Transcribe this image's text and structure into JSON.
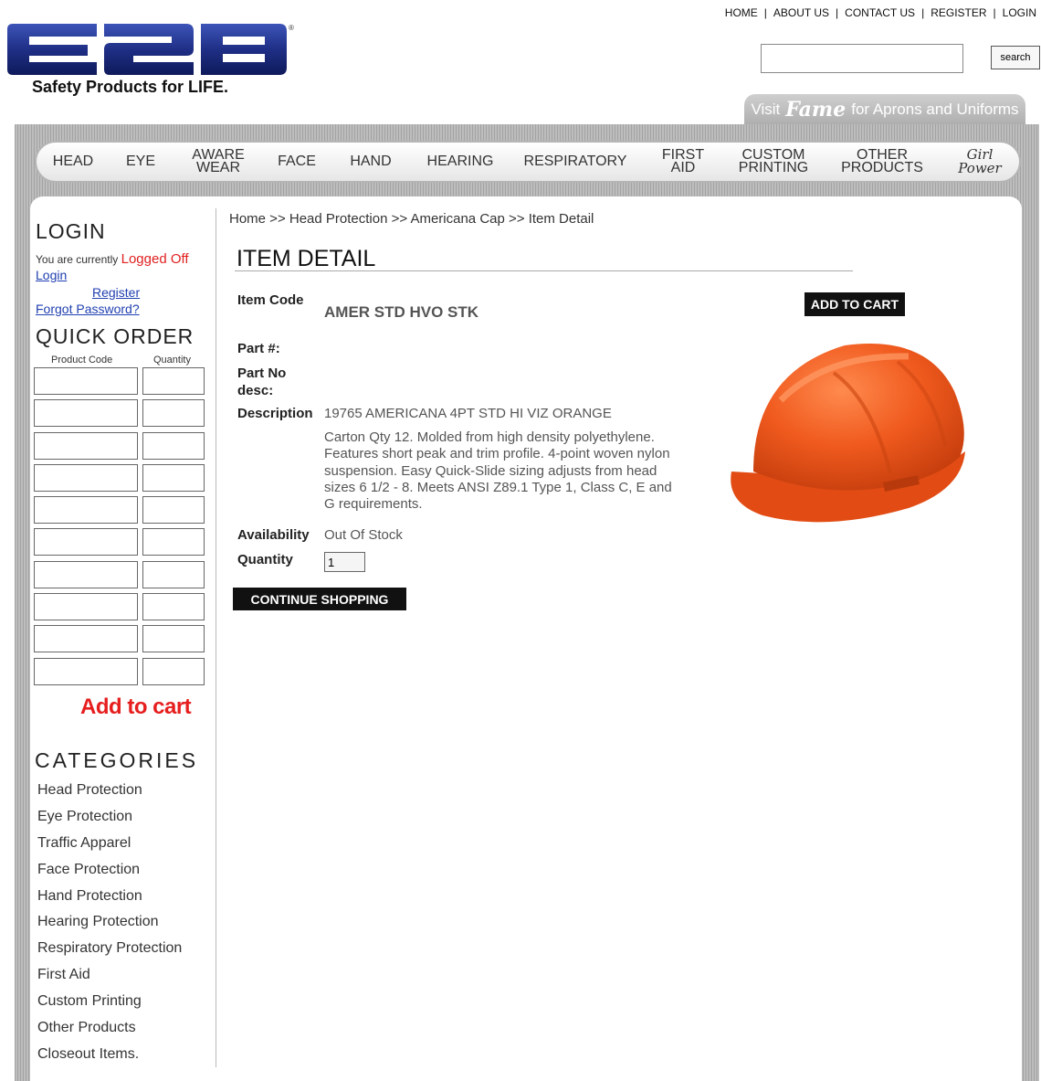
{
  "header": {
    "tagline": "Safety Products for LIFE.",
    "top_nav": [
      "HOME",
      "ABOUT US",
      "CONTACT US",
      "REGISTER",
      "LOGIN"
    ],
    "top_nav_separator": "|",
    "search": {
      "value": "",
      "button_label": "search"
    },
    "fame_banner": {
      "prefix": "Visit",
      "brand": "Fame",
      "suffix": "for Aprons and Uniforms"
    }
  },
  "main_nav": {
    "head": "HEAD",
    "eye": "EYE",
    "aware_wear": [
      "AWARE",
      "WEAR"
    ],
    "face": "FACE",
    "hand": "HAND",
    "hearing": "HEARING",
    "respiratory": "RESPIRATORY",
    "first_aid": [
      "FIRST",
      "AID"
    ],
    "custom_printing": [
      "CUSTOM",
      "PRINTING"
    ],
    "other_products": [
      "OTHER",
      "PRODUCTS"
    ],
    "girl_power": [
      "Girl",
      "Power"
    ]
  },
  "sidebar": {
    "login_heading": "LOGIN",
    "status_prefix": "You are currently",
    "status_value": "Logged Off",
    "login_link": "Login",
    "register_link": "Register",
    "forgot_link": "Forgot Password?",
    "quick_order_heading": "QUICK ORDER",
    "quick_order_col_code": "Product Code",
    "quick_order_col_qty": "Quantity",
    "add_to_cart": "Add to cart",
    "categories_heading": "CATEGORIES",
    "categories": [
      "Head Protection",
      "Eye Protection",
      "Traffic Apparel",
      "Face Protection",
      "Hand Protection",
      "Hearing Protection",
      "Respiratory Protection",
      "First Aid",
      "Custom Printing",
      "Other Products",
      "Closeout Items."
    ]
  },
  "main": {
    "breadcrumb": "Home >> Head Protection >> Americana Cap >> Item Detail",
    "title": "ITEM DETAIL",
    "item_code_label": "Item Code",
    "item_code_value": "AMER STD HVO STK",
    "part_label": "Part #:",
    "part_desc_label": [
      "Part No",
      "desc:"
    ],
    "description_label": "Description",
    "description_value": "19765 AMERICANA 4PT STD HI VIZ ORANGE",
    "description_body": "Carton Qty 12. Molded from high density polyethylene. Features short peak and trim profile. 4-point woven nylon suspension. Easy Quick-Slide sizing adjusts from head sizes 6 1/2 - 8. Meets ANSI Z89.1 Type 1, Class C, E and G requirements.",
    "availability_label": "Availability",
    "availability_value": "Out Of Stock",
    "quantity_label": "Quantity",
    "quantity_value": "1",
    "add_to_cart_button": "ADD TO CART",
    "continue_button": "CONTINUE SHOPPING"
  },
  "colors": {
    "logo_blue": "#1f2f86",
    "logged_off": "#e02020",
    "add_to_cart_red": "#e61e1e",
    "link_blue": "#1f3fb0",
    "helmet_orange": "#f05a1e"
  }
}
